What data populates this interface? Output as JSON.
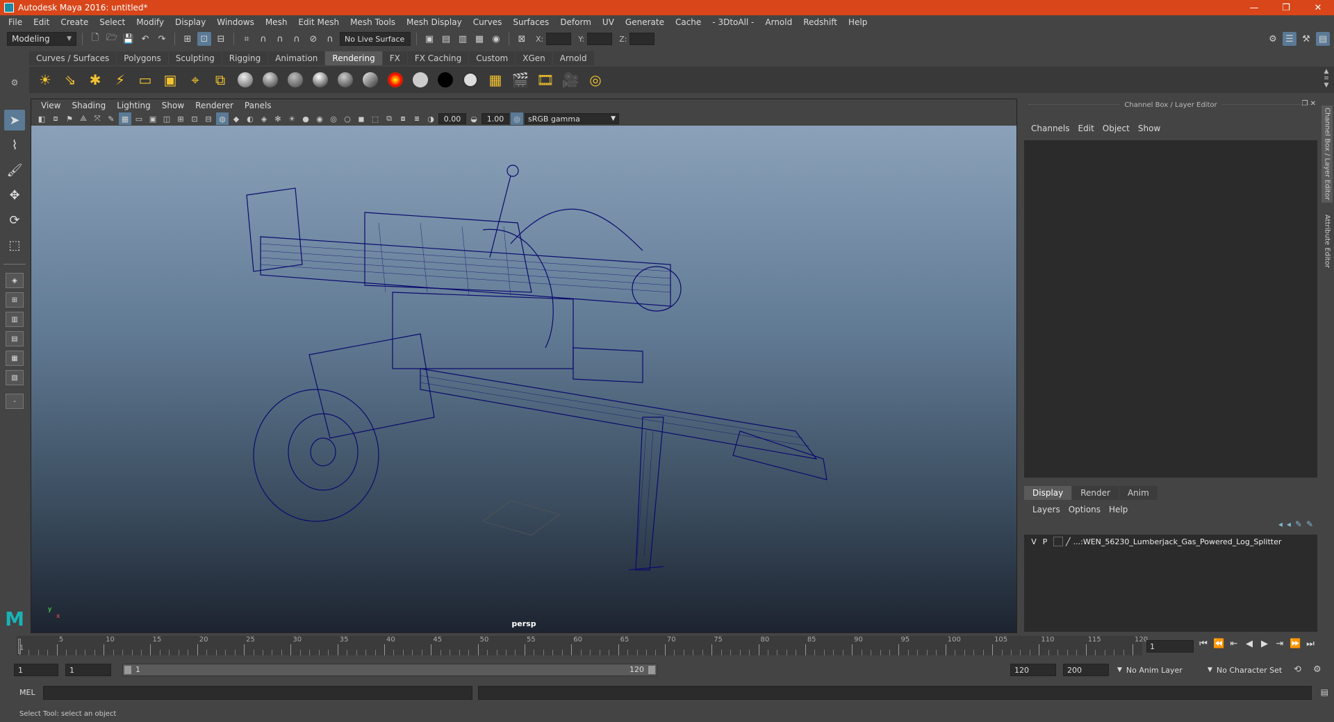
{
  "window": {
    "title": "Autodesk Maya 2016: untitled*",
    "controls": [
      "—",
      "❐",
      "✕"
    ]
  },
  "menubar": [
    "File",
    "Edit",
    "Create",
    "Select",
    "Modify",
    "Display",
    "Windows",
    "Mesh",
    "Edit Mesh",
    "Mesh Tools",
    "Mesh Display",
    "Curves",
    "Surfaces",
    "Deform",
    "UV",
    "Generate",
    "Cache",
    "- 3DtoAll -",
    "Arnold",
    "Redshift",
    "Help"
  ],
  "statusline": {
    "mode": "Modeling",
    "live_surface": "No Live Surface",
    "x_label": "X:",
    "y_label": "Y:",
    "z_label": "Z:"
  },
  "shelf": {
    "tabs": [
      "Curves / Surfaces",
      "Polygons",
      "Sculpting",
      "Rigging",
      "Animation",
      "Rendering",
      "FX",
      "FX Caching",
      "Custom",
      "XGen",
      "Arnold"
    ],
    "active_tab": "Rendering"
  },
  "viewport": {
    "menu": [
      "View",
      "Shading",
      "Lighting",
      "Show",
      "Renderer",
      "Panels"
    ],
    "exposure": "0.00",
    "gamma_value": "1.00",
    "color_space": "sRGB gamma",
    "camera": "persp",
    "wireframe_color": "#0a0a6e"
  },
  "channelbox": {
    "title": "Channel Box / Layer Editor",
    "menu": [
      "Channels",
      "Edit",
      "Object",
      "Show"
    ],
    "tabs": [
      "Display",
      "Render",
      "Anim"
    ],
    "active_tab": "Display",
    "layer_menu": [
      "Layers",
      "Options",
      "Help"
    ],
    "layer": {
      "v": "V",
      "p": "P",
      "name": "...:WEN_56230_Lumberjack_Gas_Powered_Log_Splitter"
    }
  },
  "side_tabs": [
    "Channel Box / Layer Editor",
    "Attribute Editor"
  ],
  "timeline": {
    "ticks": [
      "5",
      "10",
      "15",
      "20",
      "25",
      "30",
      "35",
      "40",
      "45",
      "50",
      "55",
      "60",
      "65",
      "70",
      "75",
      "80",
      "85",
      "90",
      "95",
      "100",
      "105",
      "110",
      "115",
      "120"
    ],
    "start_label": "1",
    "current_frame": "1"
  },
  "range": {
    "start": "1",
    "playback_start": "1",
    "slider_start": "1",
    "slider_end": "120",
    "playback_end": "120",
    "end": "200",
    "anim_layer": "No Anim Layer",
    "character_set": "No Character Set"
  },
  "cmdline": {
    "label": "MEL"
  },
  "helpline": "Select Tool: select an object"
}
